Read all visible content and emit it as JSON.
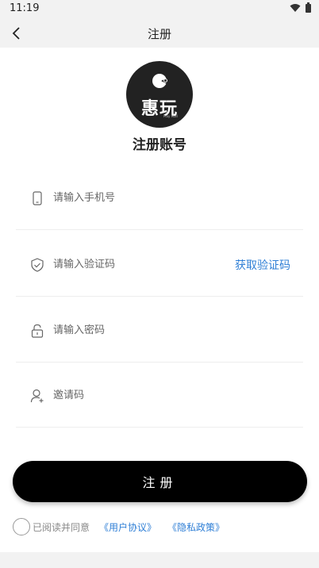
{
  "status_bar": {
    "time": "11:19"
  },
  "nav": {
    "title": "注册"
  },
  "logo": {
    "text": "惠玩",
    "subtext": "Play Mall"
  },
  "heading": "注册账号",
  "form": {
    "phone_placeholder": "请输入手机号",
    "code_placeholder": "请输入验证码",
    "get_code_label": "获取验证码",
    "password_placeholder": "请输入密码",
    "invite_placeholder": "邀请码"
  },
  "register_label": "注册",
  "agreement": {
    "text": "已阅读并同意",
    "user_agreement": "《用户协议》",
    "privacy_policy": "《隐私政策》"
  },
  "colors": {
    "link": "#2f7fd6",
    "button": "#000000",
    "background": "#f2f2f2"
  }
}
